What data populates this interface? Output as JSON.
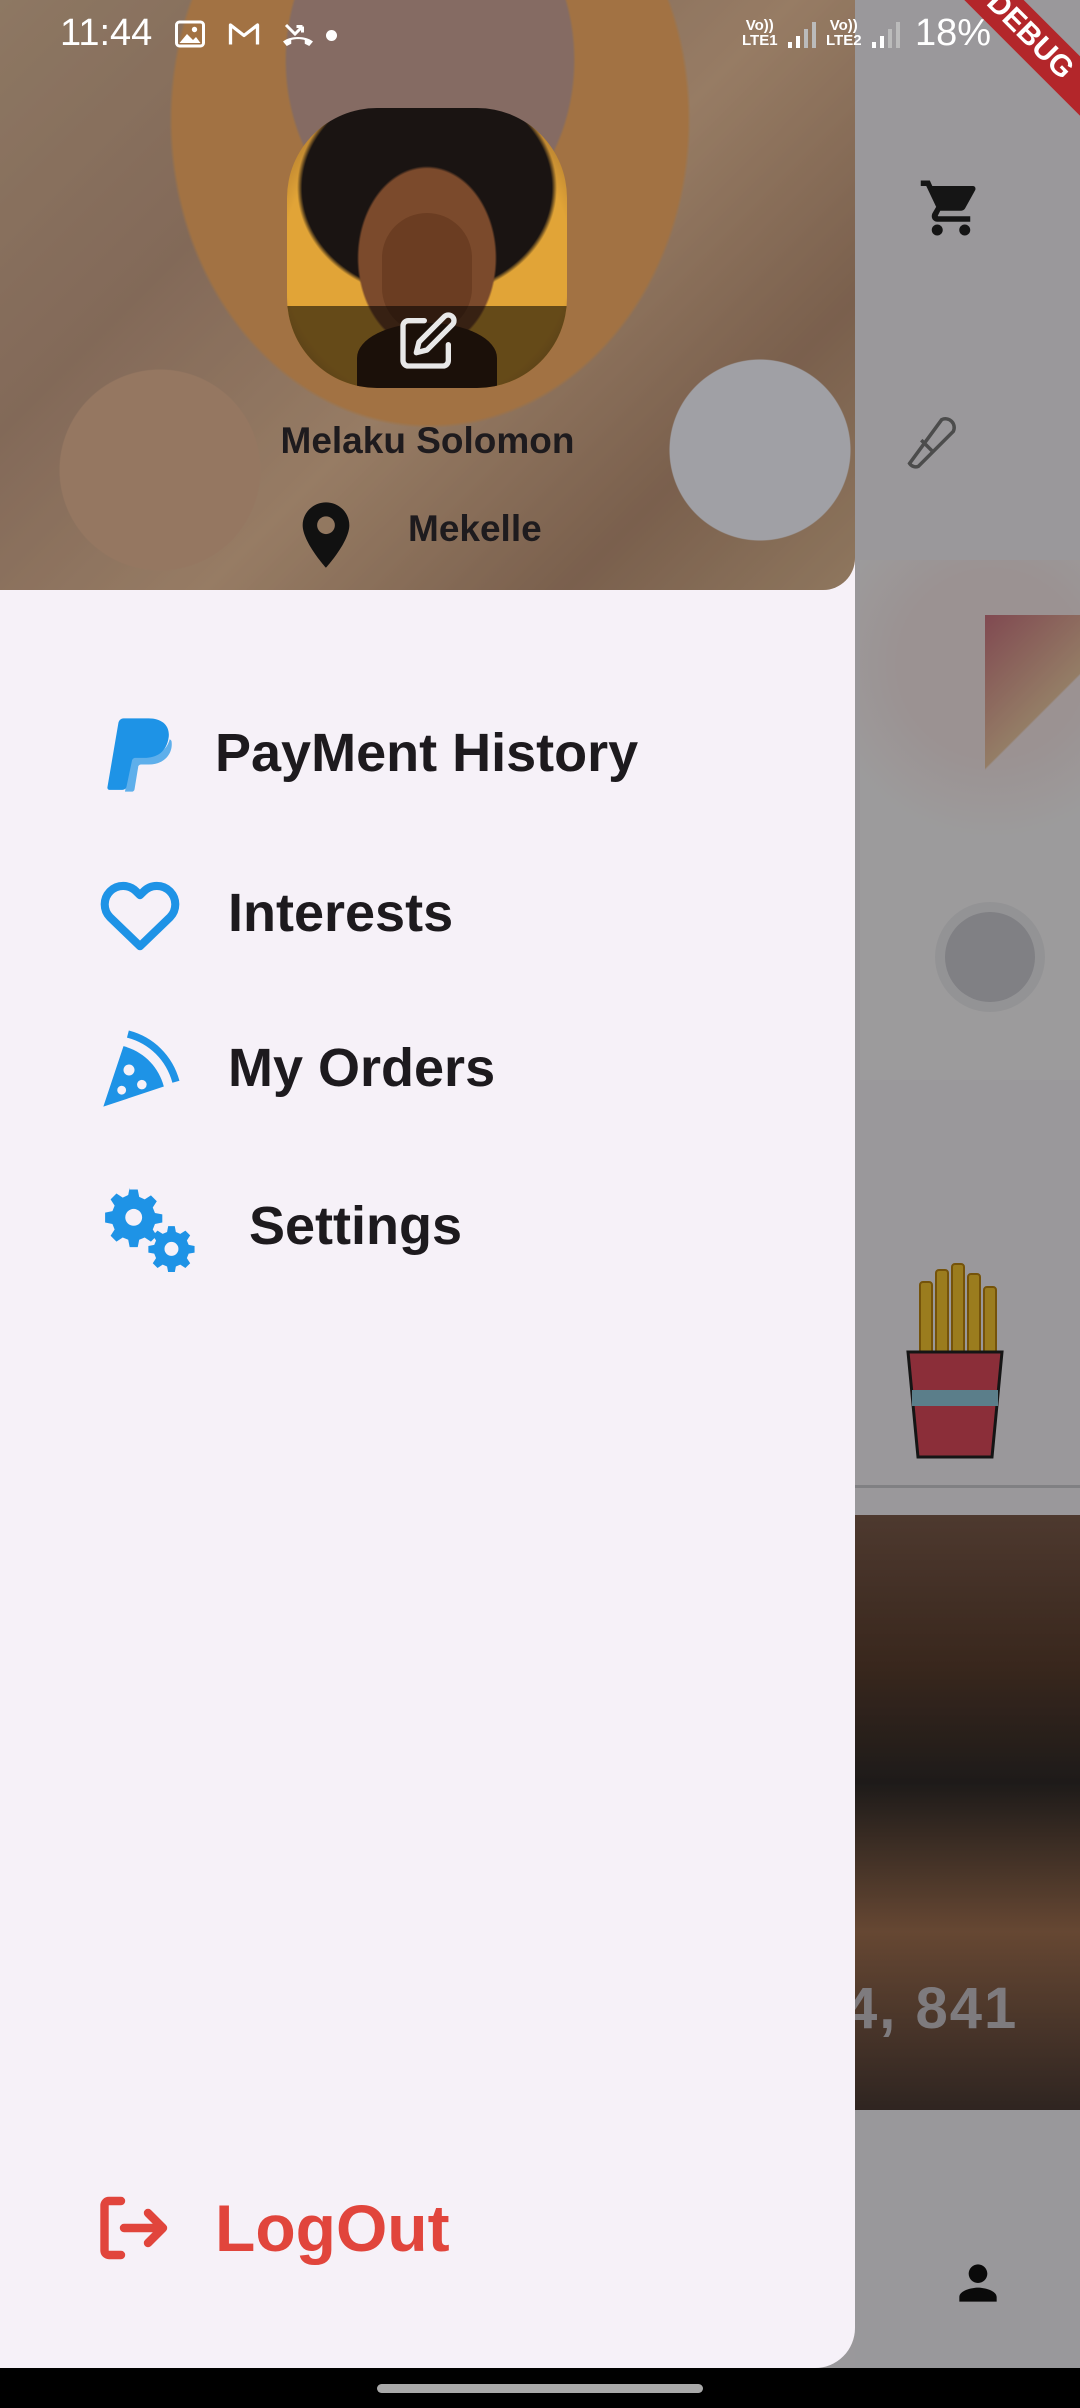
{
  "status_bar": {
    "time": "11:44",
    "battery": "18%",
    "sim1_label_top": "Vo))",
    "sim1_label_bottom": "LTE1",
    "sim2_label_top": "Vo))",
    "sim2_label_bottom": "LTE2",
    "debug_banner": "DEBUG"
  },
  "profile": {
    "name": "Melaku Solomon",
    "location": "Mekelle"
  },
  "menu": {
    "items": [
      {
        "label": "PayMent History",
        "icon": "paypal-icon"
      },
      {
        "label": "Interests",
        "icon": "heart-icon"
      },
      {
        "label": "My Orders",
        "icon": "pizza-slice-icon"
      },
      {
        "label": "Settings",
        "icon": "gears-icon"
      }
    ],
    "logout_label": "LogOut"
  },
  "background_app": {
    "price_text": "4, 841"
  },
  "colors": {
    "accent_blue": "#1e93e6",
    "logout_red": "#e1453c",
    "drawer_bg": "#f6f1f8",
    "text_dark": "#1d1a1e"
  }
}
